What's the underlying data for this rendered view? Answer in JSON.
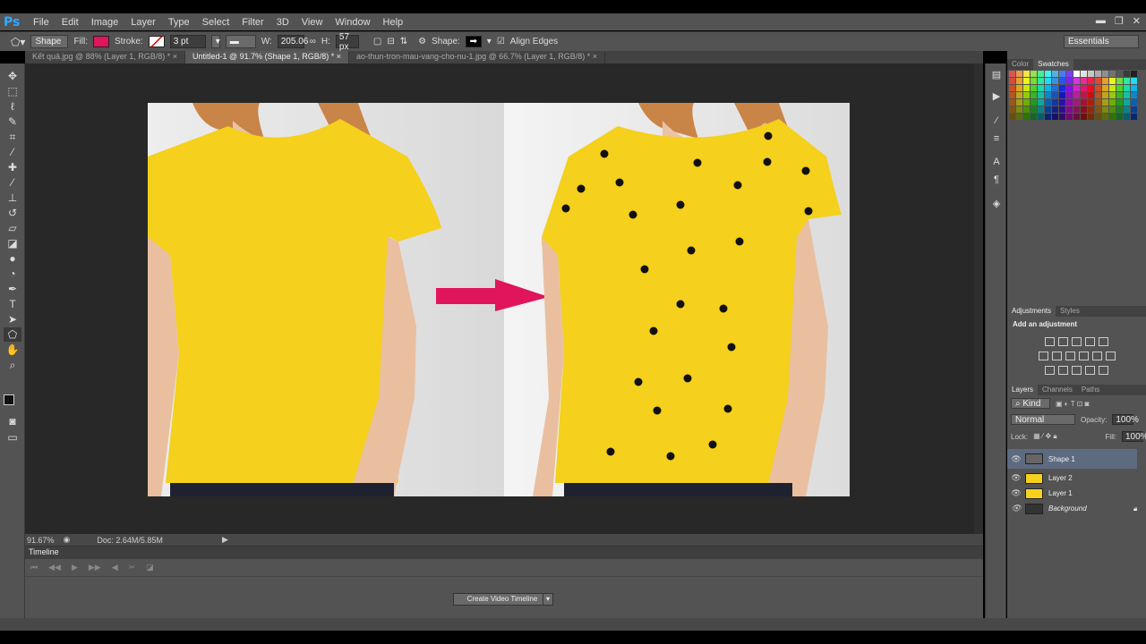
{
  "app": {
    "logo": "Ps"
  },
  "menu": [
    "File",
    "Edit",
    "Image",
    "Layer",
    "Type",
    "Select",
    "Filter",
    "3D",
    "View",
    "Window",
    "Help"
  ],
  "window_controls": [
    "▬",
    "❐",
    "✕"
  ],
  "options_bar": {
    "mode": "Shape",
    "fill_label": "Fill:",
    "fill_color": "#e0155c",
    "stroke_label": "Stroke:",
    "stroke_width": "3 pt",
    "w_label": "W:",
    "w_value": "205.06",
    "h_label": "H:",
    "h_value": "57 px",
    "shape_label": "Shape:",
    "align_edges": "Align Edges",
    "workspace": "Essentials"
  },
  "tabs": [
    {
      "label": "Kết quả.jpg @ 88% (Layer 1, RGB/8) *",
      "close": "×"
    },
    {
      "label": "Untitled-1 @ 91.7% (Shape 1, RGB/8) *",
      "close": "×"
    },
    {
      "label": "ao-thun-tron-mau-vang-cho-nu-1.jpg @ 66.7% (Layer 1, RGB/8) *",
      "close": "×"
    }
  ],
  "status": {
    "zoom": "91.67%",
    "doc": "Doc: 2.64M/5.85M"
  },
  "timeline": {
    "title": "Timeline",
    "create_button": "Create Video Timeline"
  },
  "color_panel": {
    "tabs": [
      "Color",
      "Swatches"
    ]
  },
  "adjustments": {
    "tabs": [
      "Adjustments",
      "Styles"
    ],
    "title": "Add an adjustment"
  },
  "layers_panel": {
    "tabs": [
      "Layers",
      "Channels",
      "Paths"
    ],
    "kind": "Kind",
    "blend_mode": "Normal",
    "opacity_label": "Opacity:",
    "opacity": "100%",
    "lock_label": "Lock:",
    "fill_label": "Fill:",
    "fill": "100%",
    "layers": [
      {
        "name": "Shape 1",
        "selected": true
      },
      {
        "name": "Layer 2",
        "selected": false
      },
      {
        "name": "Layer 1",
        "selected": false
      },
      {
        "name": "Background",
        "selected": false
      }
    ]
  },
  "colors": {
    "shirt": "#f5d01c",
    "arrow": "#e0155c",
    "dot": "#111111"
  }
}
